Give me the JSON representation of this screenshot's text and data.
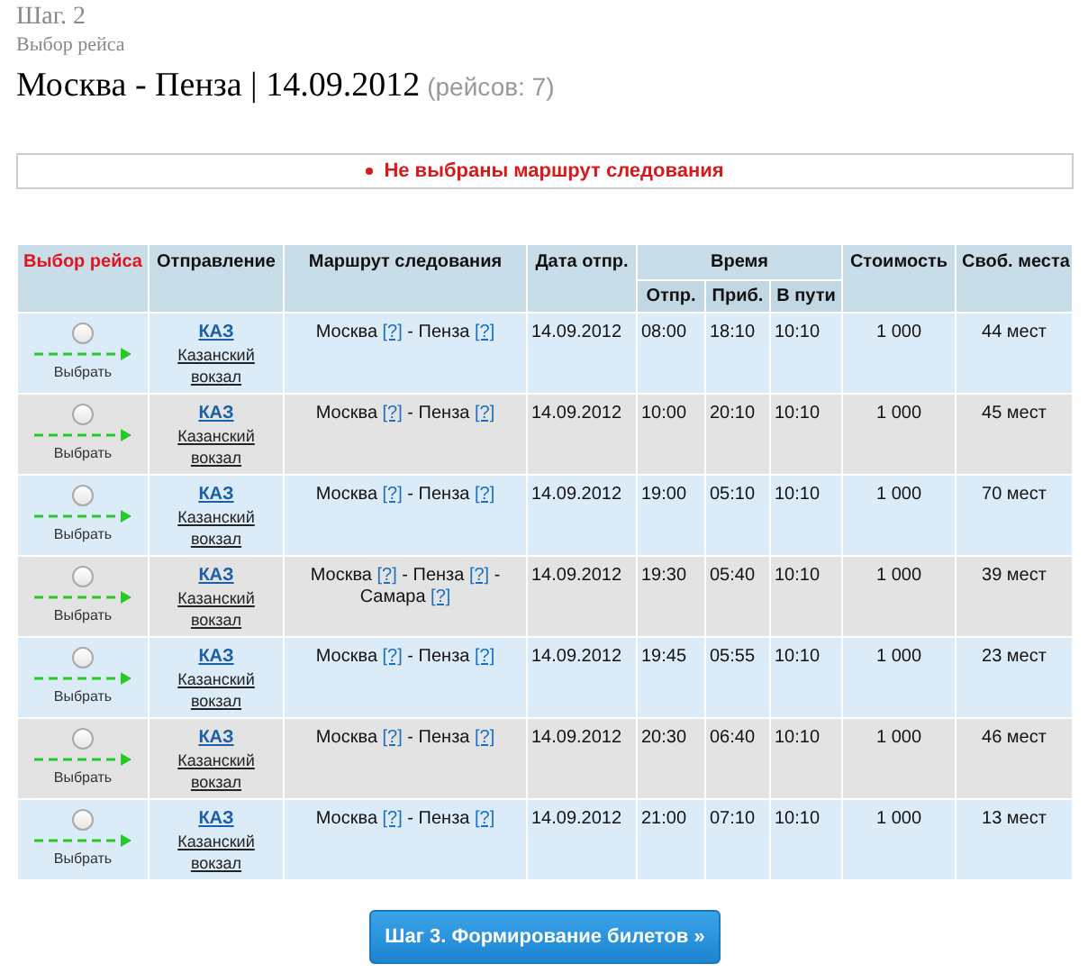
{
  "step": "Шаг. 2",
  "step_title": "Выбор рейса",
  "heading": {
    "route": "Москва - Пенза | 14.09.2012",
    "count": "(рейсов: 7)"
  },
  "errors": [
    "Не выбраны маршрут следования"
  ],
  "table": {
    "columns": {
      "choice": "Выбор рейса",
      "departure": "Отправление",
      "route": "Маршрут следования",
      "date": "Дата отпр.",
      "time": "Время",
      "time_dep": "Отпр.",
      "time_arr": "Приб.",
      "time_travel": "В пути",
      "price": "Стоимость",
      "seats": "Своб. места"
    },
    "route_separator": "-",
    "rows": [
      {
        "selected": false,
        "select_label": "Выбрать",
        "station_code": "КАЗ",
        "station": "Казанский вокзал",
        "stops": [
          {
            "name": "Москва",
            "info": "[?]"
          },
          {
            "name": "Пенза",
            "info": "[?]"
          }
        ],
        "date": "14.09.2012",
        "dep": "08:00",
        "arr": "18:10",
        "travel": "10:10",
        "price": "1 000",
        "seats": "44 мест"
      },
      {
        "selected": false,
        "select_label": "Выбрать",
        "station_code": "КАЗ",
        "station": "Казанский вокзал",
        "stops": [
          {
            "name": "Москва",
            "info": "[?]"
          },
          {
            "name": "Пенза",
            "info": "[?]"
          }
        ],
        "date": "14.09.2012",
        "dep": "10:00",
        "arr": "20:10",
        "travel": "10:10",
        "price": "1 000",
        "seats": "45 мест"
      },
      {
        "selected": false,
        "select_label": "Выбрать",
        "station_code": "КАЗ",
        "station": "Казанский вокзал",
        "stops": [
          {
            "name": "Москва",
            "info": "[?]"
          },
          {
            "name": "Пенза",
            "info": "[?]"
          }
        ],
        "date": "14.09.2012",
        "dep": "19:00",
        "arr": "05:10",
        "travel": "10:10",
        "price": "1 000",
        "seats": "70 мест"
      },
      {
        "selected": false,
        "select_label": "Выбрать",
        "station_code": "КАЗ",
        "station": "Казанский вокзал",
        "stops": [
          {
            "name": "Москва",
            "info": "[?]"
          },
          {
            "name": "Пенза",
            "info": "[?]"
          },
          {
            "name": "Самара",
            "info": "[?]"
          }
        ],
        "date": "14.09.2012",
        "dep": "19:30",
        "arr": "05:40",
        "travel": "10:10",
        "price": "1 000",
        "seats": "39 мест"
      },
      {
        "selected": false,
        "select_label": "Выбрать",
        "station_code": "КАЗ",
        "station": "Казанский вокзал",
        "stops": [
          {
            "name": "Москва",
            "info": "[?]"
          },
          {
            "name": "Пенза",
            "info": "[?]"
          }
        ],
        "date": "14.09.2012",
        "dep": "19:45",
        "arr": "05:55",
        "travel": "10:10",
        "price": "1 000",
        "seats": "23 мест"
      },
      {
        "selected": false,
        "select_label": "Выбрать",
        "station_code": "КАЗ",
        "station": "Казанский вокзал",
        "stops": [
          {
            "name": "Москва",
            "info": "[?]"
          },
          {
            "name": "Пенза",
            "info": "[?]"
          }
        ],
        "date": "14.09.2012",
        "dep": "20:30",
        "arr": "06:40",
        "travel": "10:10",
        "price": "1 000",
        "seats": "46 мест"
      },
      {
        "selected": false,
        "select_label": "Выбрать",
        "station_code": "КАЗ",
        "station": "Казанский вокзал",
        "stops": [
          {
            "name": "Москва",
            "info": "[?]"
          },
          {
            "name": "Пенза",
            "info": "[?]"
          }
        ],
        "date": "14.09.2012",
        "dep": "21:00",
        "arr": "07:10",
        "travel": "10:10",
        "price": "1 000",
        "seats": "13 мест"
      }
    ]
  },
  "next_button": "Шаг 3. Формирование билетов »"
}
